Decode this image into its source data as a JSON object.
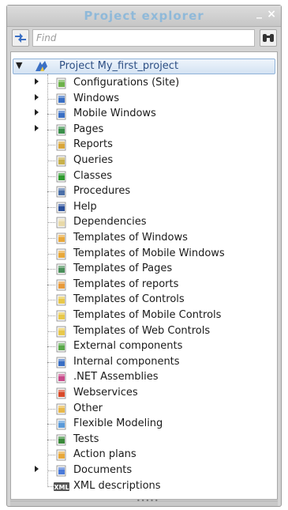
{
  "window": {
    "title": "Project explorer",
    "minimize_glyph": "_",
    "close_glyph": "×"
  },
  "search": {
    "placeholder": "Find",
    "value": ""
  },
  "tree": {
    "root": {
      "label": "Project My_first_project",
      "expanded": true
    },
    "items": [
      {
        "label": "Configurations (Site)",
        "icon": "configurations-icon",
        "expandable": true,
        "color": "#6db24a"
      },
      {
        "label": "Windows",
        "icon": "windows-folder-icon",
        "expandable": true,
        "color": "#3a6fc4"
      },
      {
        "label": "Mobile Windows",
        "icon": "mobile-windows-folder-icon",
        "expandable": true,
        "color": "#3a6fc4"
      },
      {
        "label": "Pages",
        "icon": "pages-folder-icon",
        "expandable": true,
        "color": "#3a8f4a"
      },
      {
        "label": "Reports",
        "icon": "reports-icon",
        "expandable": false,
        "color": "#d9a63a"
      },
      {
        "label": "Queries",
        "icon": "queries-icon",
        "expandable": false,
        "color": "#c8b04a"
      },
      {
        "label": "Classes",
        "icon": "classes-icon",
        "expandable": false,
        "color": "#2f9a2f"
      },
      {
        "label": "Procedures",
        "icon": "procedures-icon",
        "expandable": false,
        "color": "#4a6fa8"
      },
      {
        "label": "Help",
        "icon": "help-icon",
        "expandable": false,
        "color": "#2a4f9a"
      },
      {
        "label": "Dependencies",
        "icon": "dependencies-icon",
        "expandable": false,
        "color": "#e8d9a8"
      },
      {
        "label": "Templates of Windows",
        "icon": "templates-windows-icon",
        "expandable": false,
        "color": "#e8a83a"
      },
      {
        "label": "Templates of Mobile Windows",
        "icon": "templates-mobile-windows-icon",
        "expandable": false,
        "color": "#e8a83a"
      },
      {
        "label": "Templates of Pages",
        "icon": "templates-pages-icon",
        "expandable": false,
        "color": "#4a8f5a"
      },
      {
        "label": "Templates of reports",
        "icon": "templates-reports-icon",
        "expandable": false,
        "color": "#e89a3a"
      },
      {
        "label": "Templates of Controls",
        "icon": "templates-controls-icon",
        "expandable": false,
        "color": "#e8c84a"
      },
      {
        "label": "Templates of Mobile Controls",
        "icon": "templates-mobile-controls-icon",
        "expandable": false,
        "color": "#e8c84a"
      },
      {
        "label": "Templates of Web Controls",
        "icon": "templates-web-controls-icon",
        "expandable": false,
        "color": "#e8c84a"
      },
      {
        "label": "External components",
        "icon": "external-components-icon",
        "expandable": false,
        "color": "#5aa84a"
      },
      {
        "label": "Internal components",
        "icon": "internal-components-icon",
        "expandable": false,
        "color": "#3a6fc4"
      },
      {
        "label": ".NET Assemblies",
        "icon": "net-assemblies-icon",
        "expandable": false,
        "color": "#c84a8a"
      },
      {
        "label": "Webservices",
        "icon": "webservices-icon",
        "expandable": false,
        "color": "#d94a2a"
      },
      {
        "label": "Other",
        "icon": "other-icon",
        "expandable": false,
        "color": "#e8b84a"
      },
      {
        "label": "Flexible Modeling",
        "icon": "flexible-modeling-icon",
        "expandable": false,
        "color": "#5a9ad9"
      },
      {
        "label": "Tests",
        "icon": "tests-icon",
        "expandable": false,
        "color": "#3a8a3a"
      },
      {
        "label": "Action plans",
        "icon": "action-plans-icon",
        "expandable": false,
        "color": "#e8a83a"
      },
      {
        "label": "Documents",
        "icon": "documents-folder-icon",
        "expandable": true,
        "color": "#4a7ad9"
      },
      {
        "label": "XML descriptions",
        "icon": "xml-icon",
        "expandable": false,
        "color": "#555555",
        "badge": "XML"
      }
    ]
  }
}
